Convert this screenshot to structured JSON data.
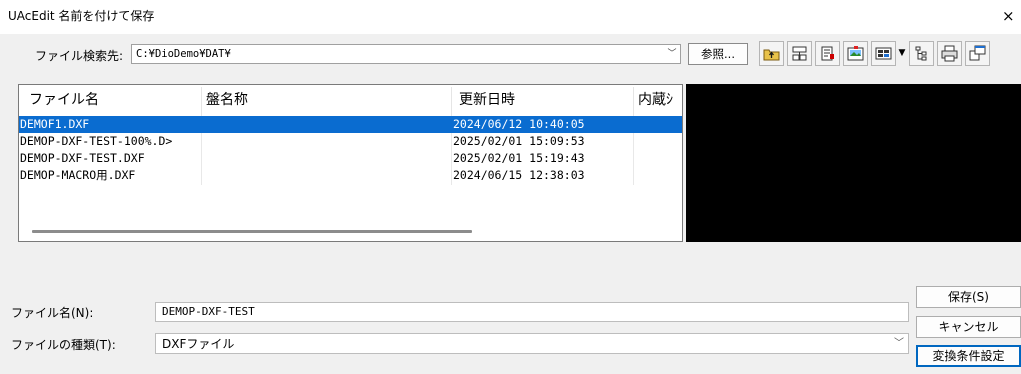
{
  "window": {
    "title": "UAcEdit 名前を付けて保存",
    "close_glyph": "×"
  },
  "search": {
    "label": "ファイル検索先:",
    "path": "C:¥DioDemo¥DAT¥",
    "browse_label": "参照..."
  },
  "toolbar": {
    "icons": [
      "up-folder-icon",
      "network-folder-icon",
      "new-folder-icon",
      "image-folder-icon",
      "view-menu-icon",
      "tree-view-icon",
      "print-icon",
      "window-arrange-icon"
    ]
  },
  "file_list": {
    "columns": [
      "ファイル名",
      "盤名称",
      "更新日時",
      "内蔵ｼ"
    ],
    "rows": [
      {
        "name": "DEMOF1.DXF",
        "board": "",
        "date": "2024/06/12 10:40:05",
        "selected": true
      },
      {
        "name": "DEMOP-DXF-TEST-100%.D>",
        "board": "",
        "date": "2025/02/01 15:09:53",
        "selected": false
      },
      {
        "name": "DEMOP-DXF-TEST.DXF",
        "board": "",
        "date": "2025/02/01 15:19:43",
        "selected": false
      },
      {
        "name": "DEMOP-MACRO用.DXF",
        "board": "",
        "date": "2024/06/15 12:38:03",
        "selected": false
      }
    ]
  },
  "form": {
    "filename_label": "ファイル名(N):",
    "filename_value": "DEMOP-DXF-TEST",
    "filetype_label": "ファイルの種類(T):",
    "filetype_value": "DXFファイル"
  },
  "buttons": {
    "save": "保存(S)",
    "cancel": "キャンセル",
    "convert": "変換条件設定"
  },
  "colors": {
    "selection": "#0a6cd0",
    "preview_bg": "#000000",
    "window_bg": "#f0f0f0"
  }
}
